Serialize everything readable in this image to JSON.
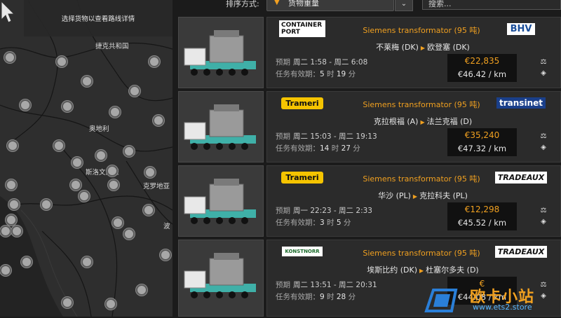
{
  "map": {
    "hint": "选择货物以查看路线详情",
    "labels": [
      "捷克共和国",
      "奥地利",
      "斯洛文尼亚",
      "克罗地亚",
      "波"
    ]
  },
  "toolbar": {
    "sort_label": "排序方式:",
    "sort_value": "货物重量",
    "search_placeholder": "搜索..."
  },
  "jobs": [
    {
      "source_logo": "CONTAINER PORT",
      "cargo": "Siemens transformator (95 吨)",
      "dest_logo": "BHV",
      "from": "不莱梅 (DK)",
      "to": "欧登塞 (DK)",
      "sched_label": "预期",
      "sched": "周二 1:58 - 周二 6:08",
      "valid_label": "任务有效期：",
      "valid_h": "5",
      "valid_m": "19",
      "total": "€22,835",
      "per_km": "€46.42 / km"
    },
    {
      "source_logo": "Trameri",
      "cargo": "Siemens transformator (95 吨)",
      "dest_logo": "transinet",
      "from": "克拉根福 (A)",
      "to": "法兰克福 (D)",
      "sched_label": "预期",
      "sched": "周二 15:03 - 周二 19:13",
      "valid_label": "任务有效期：",
      "valid_h": "14",
      "valid_m": "27",
      "total": "€35,240",
      "per_km": "€47.32 / km"
    },
    {
      "source_logo": "Trameri",
      "cargo": "Siemens transformator (95 吨)",
      "dest_logo": "TRADEAUX",
      "from": "华沙 (PL)",
      "to": "克拉科夫 (PL)",
      "sched_label": "预期",
      "sched": "周一 22:23 - 周二 2:33",
      "valid_label": "任务有效期：",
      "valid_h": "3",
      "valid_m": "5",
      "total": "€12,298",
      "per_km": "€45.52 / km"
    },
    {
      "source_logo": "KONSTNORR",
      "cargo": "Siemens transformator (95 吨)",
      "dest_logo": "TRADEAUX",
      "from": "埃斯比约 (DK)",
      "to": "杜塞尔多夫 (D)",
      "sched_label": "预期",
      "sched": "周二 13:51 - 周二 20:31",
      "valid_label": "任务有效期：",
      "valid_h": "9",
      "valid_m": "28",
      "total": "€",
      "per_km": "€44.08 / km"
    }
  ],
  "units": {
    "hour": "时",
    "minute": "分"
  },
  "watermark": {
    "text": "欧卡小站",
    "url": "www.ets2.store"
  },
  "colors": {
    "accent": "#f0a020",
    "panel": "#2b2b2b",
    "bg": "#1b1b1b"
  }
}
